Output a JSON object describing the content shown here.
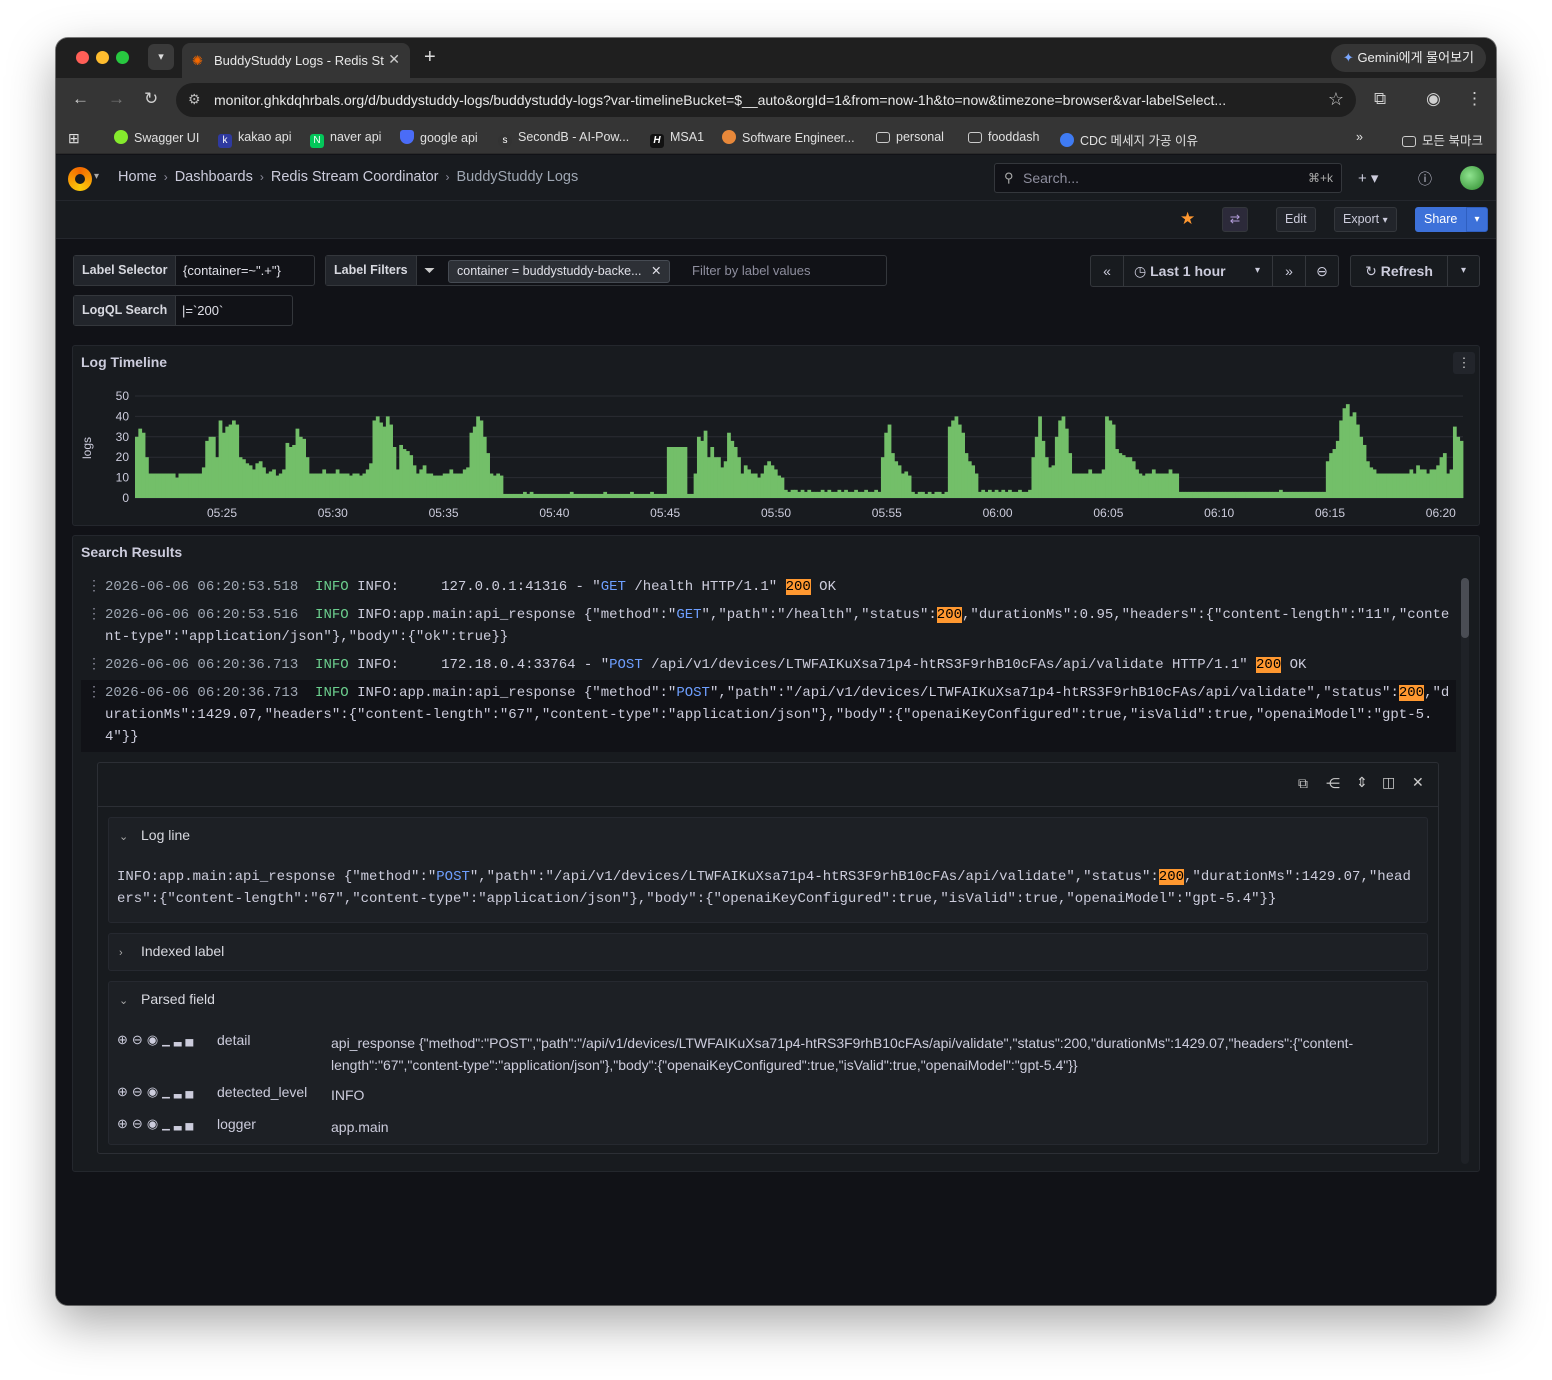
{
  "browser": {
    "tab_title": "BuddyStuddy Logs - Redis Stream Coordinator",
    "gemini_label": "Gemini에게 물어보기",
    "url": "monitor.ghkdqhrbals.org/d/buddystuddy-logs/buddystuddy-logs?var-timelineBucket=$__auto&orgId=1&from=now-1h&to=now&timezone=browser&var-labelSelect...",
    "bookmarks": [
      "Swagger UI",
      "kakao api",
      "naver api",
      "google api",
      "SecondB - AI-Pow...",
      "MSA1",
      "Software Engineer...",
      "personal",
      "fooddash",
      "CDC 메세지 가공 이유"
    ],
    "all_bookmarks": "모든 북마크"
  },
  "breadcrumbs": {
    "home": "Home",
    "dashboards": "Dashboards",
    "folder": "Redis Stream Coordinator",
    "current": "BuddyStuddy Logs"
  },
  "search": {
    "placeholder": "Search...",
    "shortcut": "⌘+k"
  },
  "actions": {
    "edit": "Edit",
    "export": "Export",
    "share": "Share"
  },
  "variables": {
    "label_selector": {
      "label": "Label Selector",
      "value": "{container=~\".+\"}"
    },
    "label_filters": {
      "label": "Label Filters",
      "chip": "container = buddystuddy-backe...",
      "placeholder": "Filter by label values"
    },
    "logql_search": {
      "label": "LogQL Search",
      "value": "|=`200`"
    }
  },
  "time": {
    "range": "Last 1 hour",
    "refresh": "Refresh"
  },
  "timeline_panel": {
    "title": "Log Timeline",
    "chart_data": {
      "type": "bar",
      "ylabel": "logs",
      "ylim": [
        0,
        50
      ],
      "yticks": [
        0,
        10,
        20,
        30,
        40,
        50
      ],
      "xticks": [
        "05:25",
        "05:30",
        "05:35",
        "05:40",
        "05:45",
        "05:50",
        "05:55",
        "06:00",
        "06:05",
        "06:10",
        "06:15",
        "06:20"
      ],
      "color": "#73bf69",
      "values": [
        30,
        34,
        32,
        20,
        12,
        12,
        12,
        12,
        12,
        12,
        12,
        12,
        10,
        12,
        12,
        12,
        12,
        12,
        12,
        12,
        15,
        28,
        30,
        30,
        20,
        38,
        32,
        35,
        36,
        38,
        36,
        20,
        19,
        17,
        16,
        14,
        17,
        18,
        15,
        12,
        13,
        14,
        11,
        12,
        14,
        27,
        25,
        26,
        34,
        30,
        29,
        20,
        12,
        12,
        12,
        12,
        14,
        12,
        12,
        12,
        14,
        12,
        12,
        12,
        11,
        12,
        12,
        11,
        12,
        14,
        17,
        38,
        40,
        37,
        35,
        40,
        36,
        25,
        14,
        26,
        24,
        23,
        21,
        16,
        12,
        14,
        16,
        12,
        12,
        11,
        11,
        11,
        12,
        12,
        14,
        12,
        12,
        12,
        14,
        15,
        32,
        35,
        40,
        38,
        30,
        22,
        12,
        11,
        12,
        11,
        2,
        2,
        2,
        2,
        2,
        2,
        3,
        2,
        3,
        2,
        2,
        2,
        2,
        2,
        2,
        2,
        2,
        2,
        2,
        2,
        3,
        2,
        2,
        2,
        2,
        2,
        2,
        2,
        2,
        2,
        3,
        2,
        2,
        2,
        2,
        2,
        2,
        2,
        3,
        2,
        2,
        2,
        2,
        2,
        3,
        2,
        2,
        2,
        2,
        25,
        25,
        25,
        25,
        25,
        25,
        2,
        2,
        12,
        30,
        28,
        33,
        20,
        25,
        20,
        20,
        15,
        18,
        32,
        28,
        25,
        20,
        12,
        16,
        14,
        12,
        12,
        10,
        12,
        16,
        18,
        16,
        14,
        11,
        10,
        4,
        3,
        4,
        4,
        3,
        4,
        3,
        4,
        3,
        3,
        3,
        4,
        3,
        4,
        3,
        3,
        4,
        3,
        4,
        3,
        3,
        4,
        3,
        3,
        4,
        3,
        3,
        4,
        3,
        20,
        32,
        36,
        22,
        18,
        16,
        12,
        13,
        11,
        3,
        2,
        3,
        3,
        2,
        3,
        2,
        3,
        3,
        2,
        3,
        35,
        38,
        40,
        36,
        32,
        22,
        18,
        16,
        12,
        3,
        4,
        3,
        4,
        3,
        4,
        3,
        4,
        3,
        4,
        3,
        3,
        4,
        3,
        3,
        4,
        20,
        30,
        40,
        28,
        20,
        15,
        16,
        30,
        38,
        40,
        34,
        22,
        12,
        12,
        12,
        12,
        12,
        14,
        12,
        12,
        12,
        14,
        40,
        38,
        36,
        24,
        22,
        21,
        20,
        20,
        18,
        14,
        12,
        11,
        12,
        12,
        14,
        12,
        12,
        12,
        12,
        14,
        12,
        12,
        3,
        3,
        3,
        3,
        3,
        3,
        3,
        3,
        3,
        3,
        3,
        3,
        3,
        3,
        3,
        3,
        3,
        3,
        3,
        3,
        3,
        3,
        3,
        3,
        3,
        3,
        3,
        3,
        3,
        3,
        4,
        3,
        3,
        3,
        3,
        3,
        3,
        3,
        3,
        3,
        3,
        3,
        3,
        3,
        18,
        22,
        24,
        28,
        38,
        44,
        46,
        40,
        42,
        36,
        30,
        26,
        18,
        15,
        14,
        12,
        12,
        12,
        12,
        12,
        12,
        12,
        12,
        12,
        12,
        14,
        12,
        16,
        14,
        14,
        12,
        14,
        14,
        16,
        20,
        22,
        12,
        14,
        35,
        30,
        28
      ]
    }
  },
  "results_panel": {
    "title": "Search Results",
    "rows": [
      {
        "ts": "2026-06-06 06:20:53.518",
        "level": "INFO",
        "msg_a": "INFO:     127.0.0.1:41316 - \"",
        "method": "GET",
        "msg_b": " /health HTTP/1.1\" ",
        "hl": "200",
        "msg_c": " OK"
      },
      {
        "ts": "2026-06-06 06:20:53.516",
        "level": "INFO",
        "msg_a": "INFO:app.main:api_response {\"method\":\"",
        "method": "GET",
        "msg_b": "\",\"path\":\"/health\",\"status\":",
        "hl": "200",
        "msg_c": ",\"durationMs\":0.95,\"headers\":{\"content-length\":\"11\",\"content-type\":\"application/json\"},\"body\":{\"ok\":true}}"
      },
      {
        "ts": "2026-06-06 06:20:36.713",
        "level": "INFO",
        "msg_a": "INFO:     172.18.0.4:33764 - \"",
        "method": "POST",
        "msg_b": " /api/v1/devices/LTWFAIKuXsa71p4-htRS3F9rhB10cFAs/api/validate HTTP/1.1\" ",
        "hl": "200",
        "msg_c": " OK"
      },
      {
        "ts": "2026-06-06 06:20:36.713",
        "level": "INFO",
        "msg_a": "INFO:app.main:api_response {\"method\":\"",
        "method": "POST",
        "msg_b": "\",\"path\":\"/api/v1/devices/LTWFAIKuXsa71p4-htRS3F9rhB10cFAs/api/validate\",\"status\":",
        "hl": "200",
        "msg_c": ",\"durationMs\":1429.07,\"headers\":{\"content-length\":\"67\",\"content-type\":\"application/json\"},\"body\":{\"openaiKeyConfigured\":true,\"isValid\":true,\"openaiModel\":\"gpt-5.4\"}}"
      }
    ],
    "details": {
      "log_line_title": "Log line",
      "log_line": {
        "a": "INFO:app.main:api_response {\"method\":\"",
        "method": "POST",
        "b": "\",\"path\":\"/api/v1/devices/LTWFAIKuXsa71p4-htRS3F9rhB10cFAs/api/validate\",\"status\":",
        "hl": "200",
        "c": ",\"durationMs\":1429.07,\"headers\":{\"content-length\":\"67\",\"content-type\":\"application/json\"},\"body\":{\"openaiKeyConfigured\":true,\"isValid\":true,\"openaiModel\":\"gpt-5.4\"}}"
      },
      "indexed_label_title": "Indexed label",
      "parsed_field_title": "Parsed field",
      "fields": [
        {
          "key": "detail",
          "value": "api_response {\"method\":\"POST\",\"path\":\"/api/v1/devices/LTWFAIKuXsa71p4-htRS3F9rhB10cFAs/api/validate\",\"status\":200,\"durationMs\":1429.07,\"headers\":{\"content-length\":\"67\",\"content-type\":\"application/json\"},\"body\":{\"openaiKeyConfigured\":true,\"isValid\":true,\"openaiModel\":\"gpt-5.4\"}}"
        },
        {
          "key": "detected_level",
          "value": "INFO"
        },
        {
          "key": "logger",
          "value": "app.main"
        }
      ]
    }
  }
}
